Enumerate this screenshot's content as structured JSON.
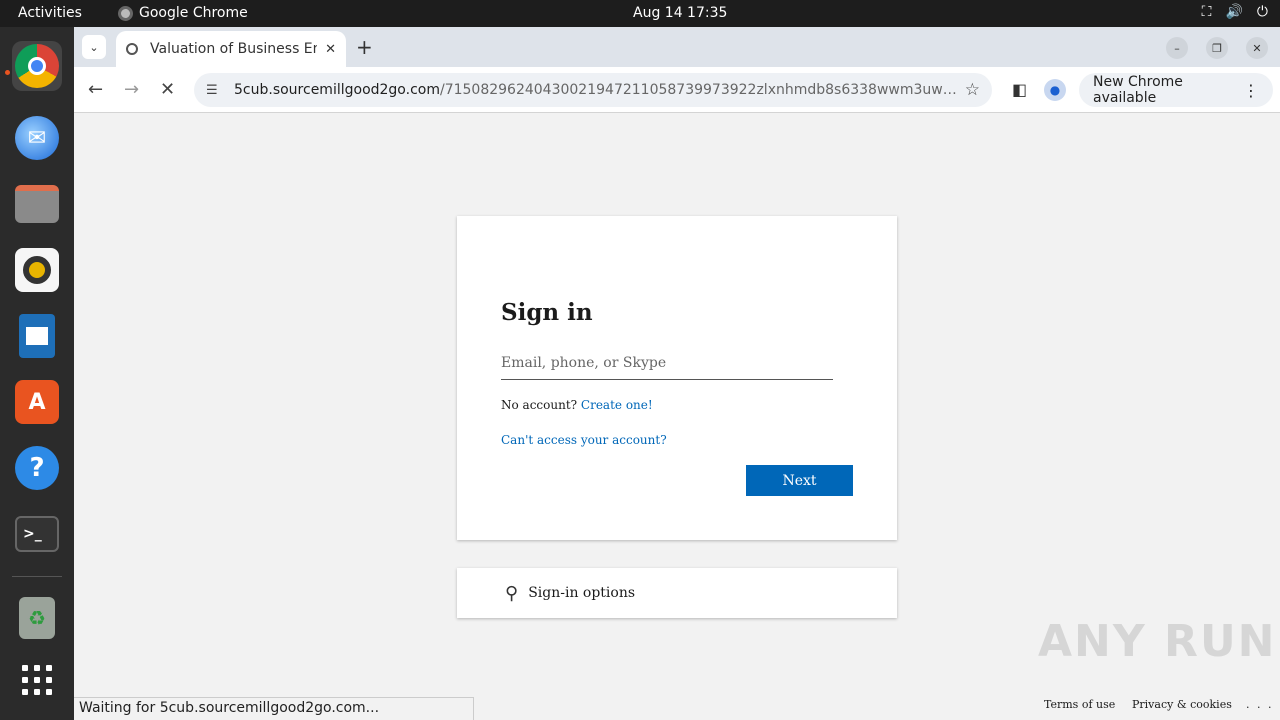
{
  "topbar": {
    "activities": "Activities",
    "app_name": "Google Chrome",
    "clock": "Aug 14  17:35"
  },
  "tab": {
    "title": "Valuation of Business En",
    "close": "✕",
    "new_tab": "+"
  },
  "toolbar": {
    "url_host": "5cub.sourcemillgood2go.com",
    "url_path": "/71508296240430021947211058739973922zlxnhmdb8s6338wwm3uwvf31ex24b...",
    "update_label": "New Chrome available",
    "update_more": "⋮"
  },
  "signin": {
    "title": "Sign in",
    "email_placeholder": "Email, phone, or Skype",
    "no_account": "No account?",
    "create_link": "Create one!",
    "cant_access": "Can't access your account?",
    "next": "Next"
  },
  "signin_options": {
    "label": "Sign-in options"
  },
  "footer": {
    "terms": "Terms of use",
    "privacy": "Privacy & cookies",
    "more": ". . ."
  },
  "status_bar": "Waiting for 5cub.sourcemillgood2go.com...",
  "watermark": "ANY RUN"
}
